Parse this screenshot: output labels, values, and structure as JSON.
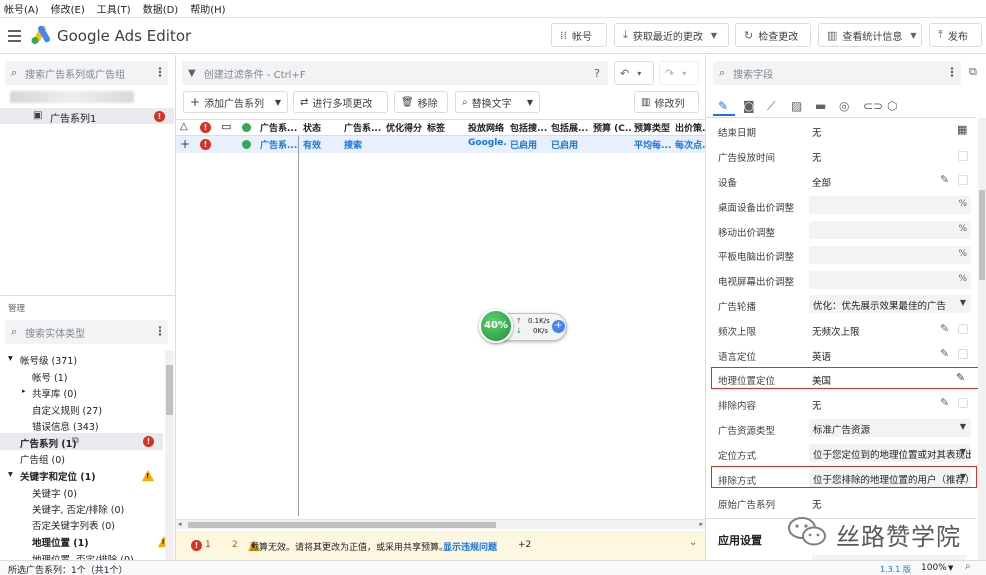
{
  "menu": [
    "帐号(A)",
    "修改(E)",
    "工具(T)",
    "数据(D)",
    "帮助(H)"
  ],
  "app": {
    "title": "Google Ads Editor"
  },
  "toolbar": {
    "account": "帐号",
    "fetch": "获取最近的更改",
    "check": "检查更改",
    "stats": "查看统计信息",
    "publish": "发布"
  },
  "left": {
    "search_placeholder": "搜索广告系列或广告组",
    "campaign_name": "广告系列1",
    "manage_label": "管理",
    "entity_search_placeholder": "搜索实体类型",
    "tree": {
      "account_level": "帐号级 (371)",
      "account": "帐号 (1)",
      "shared_library": "共享库 (0)",
      "custom_rules": "自定义规则 (27)",
      "errors": "错误信息 (343)",
      "campaigns": "广告系列 (1)",
      "ad_groups": "广告组 (0)",
      "keywords_targeting": "关键字和定位 (1)",
      "keywords": "关键字 (0)",
      "keywords_negative": "关键字, 否定/排除 (0)",
      "negative_keyword_lists": "否定关键字列表 (0)",
      "location": "地理位置 (1)",
      "location_negative": "地理位置, 否定/排除 (0)"
    }
  },
  "center": {
    "filter_placeholder": "创建过滤条件 - Ctrl+F",
    "add_campaign": "添加广告系列",
    "multi_edit": "进行多项更改",
    "remove": "移除",
    "replace_text": "替换文字",
    "edit_columns": "修改列",
    "columns": [
      "广告系...",
      "状态",
      "广告系...",
      "优化得分",
      "标签",
      "投放网络",
      "包括搜...",
      "包括展...",
      "预算 (C...",
      "预算类型",
      "出价策..."
    ],
    "row": {
      "campaign": "广告系...",
      "status": "有效",
      "type": "搜索",
      "network": "Google...",
      "search": "已启用",
      "display": "已启用",
      "budget_type": "平均每...",
      "bid": "每次点..."
    },
    "speed_widget": {
      "percent": "40%",
      "up": "0.1K/s",
      "down": "0K/s"
    },
    "bottom": {
      "err_count": "1",
      "warn_count": "2",
      "message": "预算无效。请将其更改为正值，或采用共享预算。",
      "link": "显示违规问题",
      "more": "+2"
    }
  },
  "right": {
    "search_placeholder": "搜索字段",
    "props": [
      {
        "label": "结束日期",
        "value": "无"
      },
      {
        "label": "广告投放时间",
        "value": "无"
      },
      {
        "label": "设备",
        "value": "全部"
      },
      {
        "label": "桌面设备出价调整",
        "value": "%"
      },
      {
        "label": "移动出价调整",
        "value": "%"
      },
      {
        "label": "平板电脑出价调整",
        "value": "%"
      },
      {
        "label": "电视屏幕出价调整",
        "value": "%"
      },
      {
        "label": "广告轮播",
        "value": "优化：优先展示效果最佳的广告"
      },
      {
        "label": "频次上限",
        "value": "无频次上限"
      },
      {
        "label": "语言定位",
        "value": "英语"
      },
      {
        "label": "地理位置定位",
        "value": "美国"
      },
      {
        "label": "排除内容",
        "value": "无"
      },
      {
        "label": "广告资源类型",
        "value": "标准广告资源"
      },
      {
        "label": "定位方式",
        "value": "位于您定位到的地理位置或对其表现出兴趣的用户"
      },
      {
        "label": "排除方式",
        "value": "位于您排除的地理位置的用户（推荐）"
      },
      {
        "label": "原始广告系列",
        "value": "无"
      }
    ],
    "apply_settings": "应用设置",
    "watermark": "丝路赞学院"
  },
  "status_bar": {
    "selected": "所选广告系列：1个（共1个）",
    "version": "1.3.1 版",
    "zoom": "100%"
  },
  "colors": {
    "error": "#d93025",
    "warning": "#f9ab00",
    "accent": "#1a73e8",
    "highlight_border": "#d93025"
  }
}
